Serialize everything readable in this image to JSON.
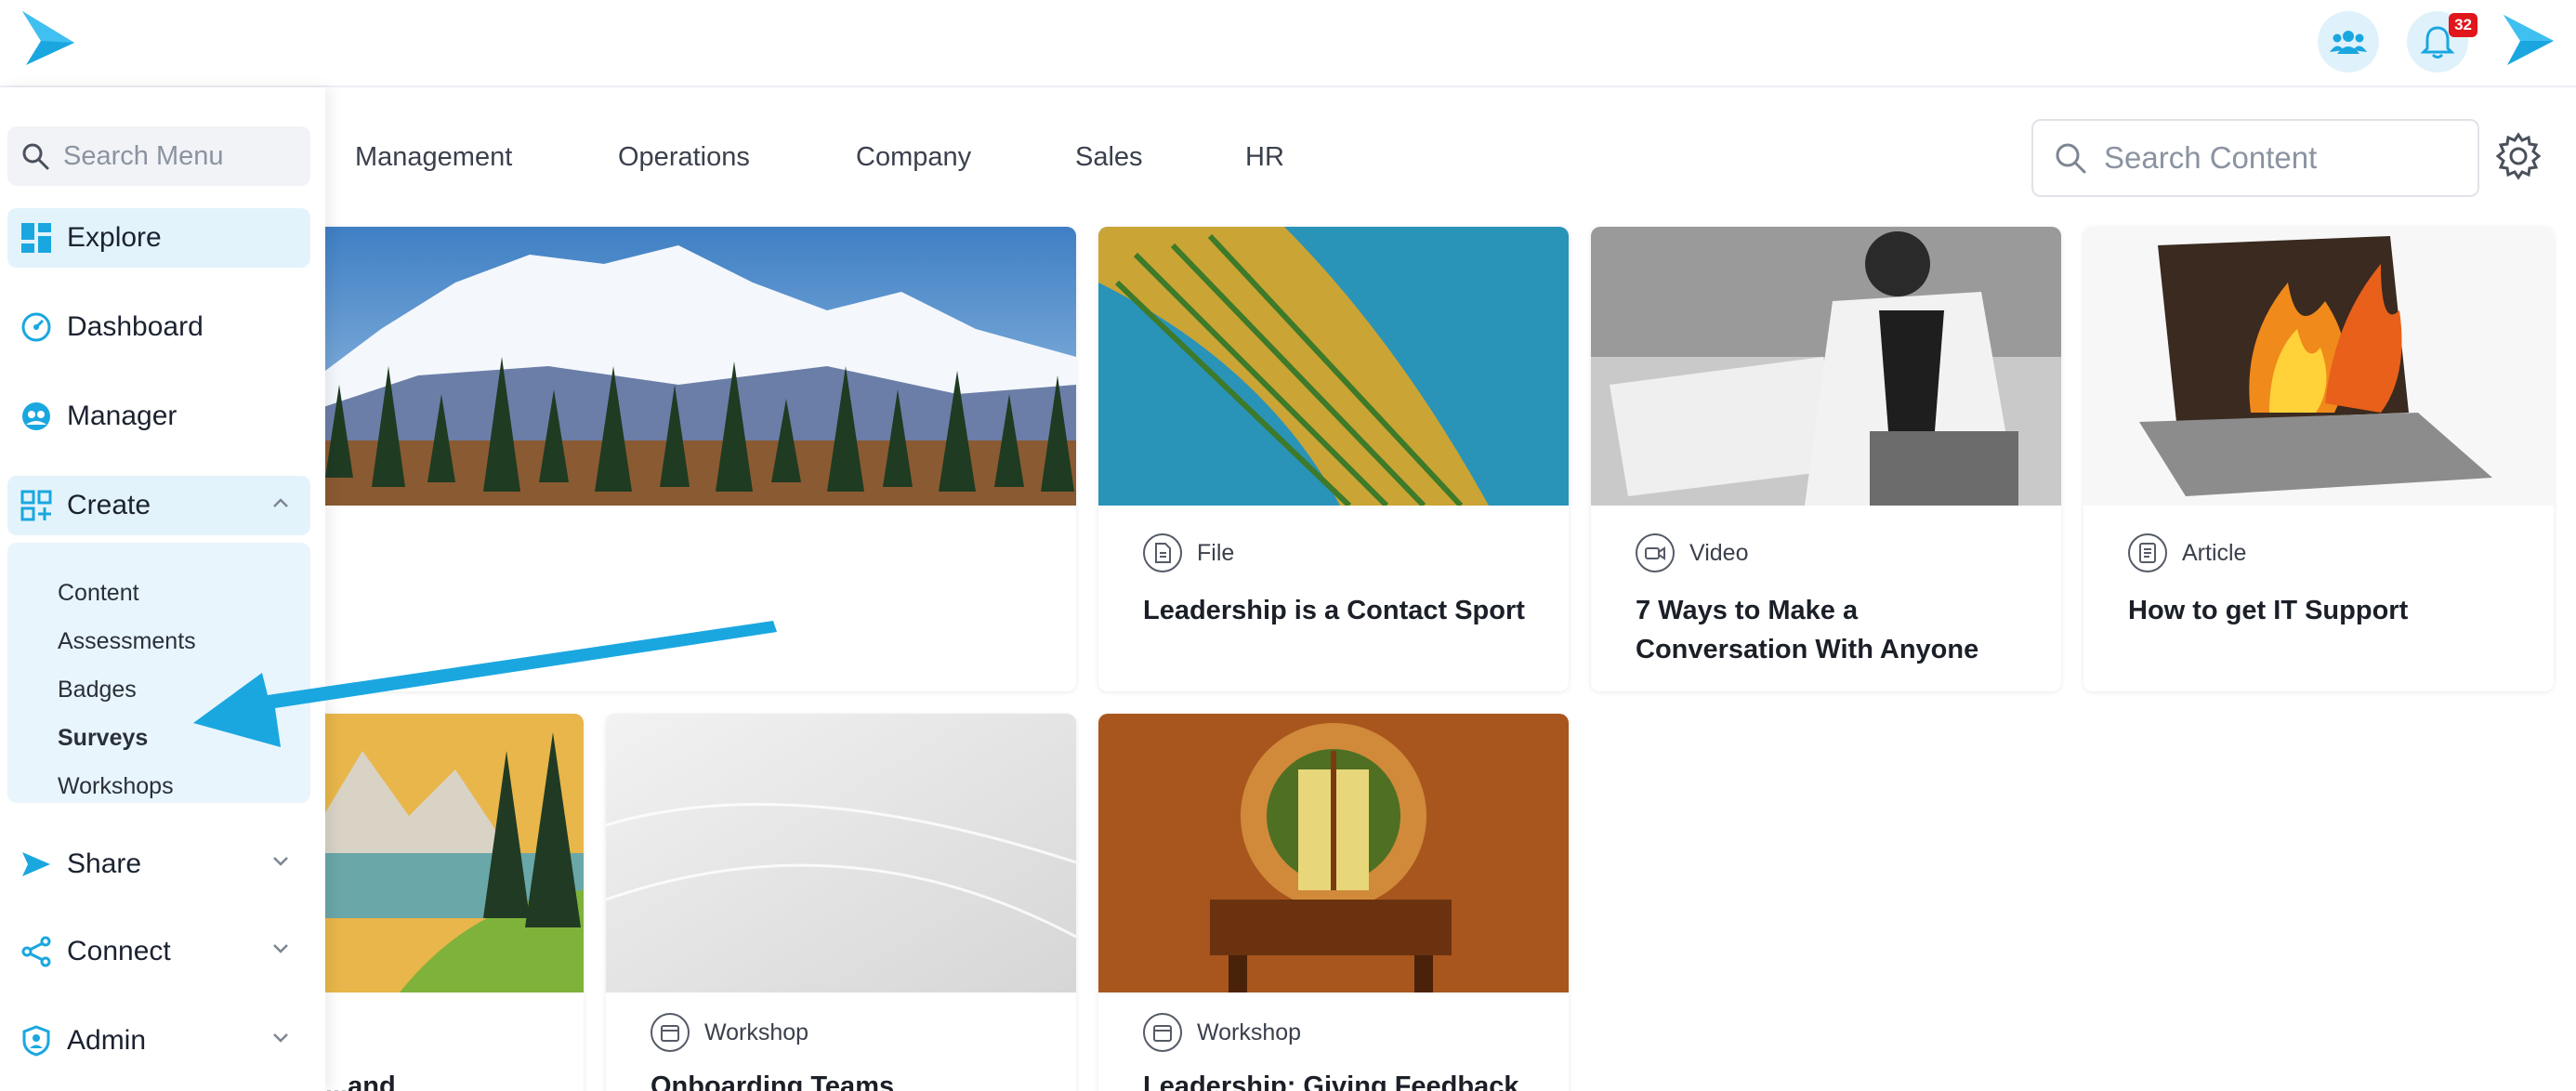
{
  "header": {
    "notification_count": "32"
  },
  "sidebar": {
    "search_placeholder": "Search Menu",
    "items": [
      {
        "label": "Explore"
      },
      {
        "label": "Dashboard"
      },
      {
        "label": "Manager"
      },
      {
        "label": "Create"
      },
      {
        "label": "Share"
      },
      {
        "label": "Connect"
      },
      {
        "label": "Admin"
      }
    ],
    "create_submenu": [
      "Content",
      "Assessments",
      "Badges",
      "Surveys",
      "Workshops"
    ]
  },
  "tabs": [
    "Management",
    "Operations",
    "Company",
    "Sales",
    "HR"
  ],
  "content_search": {
    "placeholder": "Search Content"
  },
  "cards": [
    {
      "type": "File",
      "title": "Leadership is a Contact Sport"
    },
    {
      "type": "Video",
      "title": "7 Ways to Make a Conversation With Anyone"
    },
    {
      "type": "Article",
      "title": "How to get IT Support"
    },
    {
      "type": "",
      "title": "...and"
    },
    {
      "type": "Workshop",
      "title": "Onboarding Teams"
    },
    {
      "type": "Workshop",
      "title": "Leadership: Giving Feedback"
    }
  ],
  "colors": {
    "brand": "#1aa7e0",
    "active_bg": "#e3f3fc",
    "badge": "#e1151c",
    "arrow": "#1aa7e0"
  }
}
